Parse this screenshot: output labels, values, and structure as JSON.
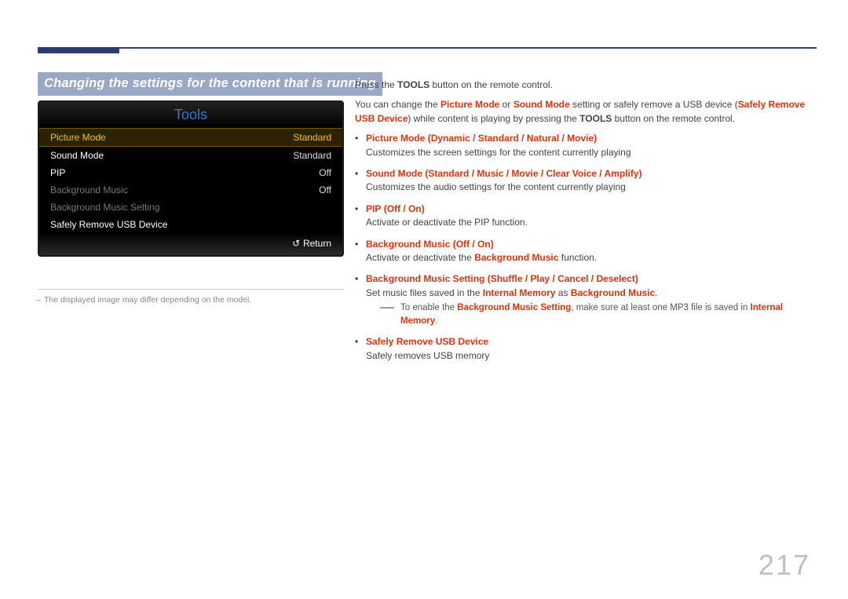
{
  "page_number": "217",
  "heading": "Changing the settings for the content that is running",
  "toolsbox": {
    "title": "Tools",
    "rows": [
      {
        "label": "Picture Mode",
        "value": "Standard",
        "state": "selected"
      },
      {
        "label": "Sound Mode",
        "value": "Standard",
        "state": "normal"
      },
      {
        "label": "PIP",
        "value": "Off",
        "state": "normal"
      },
      {
        "label": "Background Music",
        "value": "Off",
        "state": "dim"
      },
      {
        "label": "Background Music Setting",
        "value": "",
        "state": "dim"
      },
      {
        "label": "Safely Remove USB Device",
        "value": "",
        "state": "normal"
      }
    ],
    "footer": "Return"
  },
  "image_note": "The displayed image may differ depending on the model.",
  "intro1_a": "Press the ",
  "intro1_b": "TOOLS",
  "intro1_c": " button on the remote control.",
  "intro2_a": "You can change the ",
  "intro2_b": "Picture Mode",
  "intro2_c": " or ",
  "intro2_d": "Sound Mode",
  "intro2_e": " setting or safely remove a USB device (",
  "intro2_f": "Safely Remove USB Device",
  "intro2_g": ") while content is playing by pressing the ",
  "intro2_h": "TOOLS",
  "intro2_i": " button on the remote control.",
  "items": {
    "picture_mode": {
      "name": "Picture Mode",
      "opts": [
        "Dynamic",
        "Standard",
        "Natural",
        "Movie"
      ],
      "desc": "Customizes the screen settings for the content currently playing"
    },
    "sound_mode": {
      "name": "Sound Mode",
      "opts": [
        "Standard",
        "Music",
        "Movie",
        "Clear Voice",
        "Amplify"
      ],
      "desc": "Customizes the audio settings for the content currently playing"
    },
    "pip": {
      "name": "PIP",
      "opts": [
        "Off",
        "On"
      ],
      "desc": "Activate or deactivate the PIP function."
    },
    "bg_music": {
      "name": "Background Music",
      "opts": [
        "Off",
        "On"
      ],
      "desc_a": "Activate or deactivate the ",
      "desc_b": "Background Music",
      "desc_c": " function."
    },
    "bg_music_setting": {
      "name": "Background Music Setting",
      "opts": [
        "Shuffle",
        "Play",
        "Cancel",
        "Deselect"
      ],
      "desc_a": "Set music files saved in the ",
      "desc_b": "Internal Memory",
      "desc_c": " as ",
      "desc_d": "Background Music",
      "desc_e": "."
    },
    "safe_remove": {
      "name": "Safely Remove USB Device",
      "desc": "Safely removes USB memory"
    }
  },
  "bgms_note_a": "To enable the ",
  "bgms_note_b": "Background Music Setting",
  "bgms_note_c": ", make sure at least one MP3 file is saved in ",
  "bgms_note_d": "Internal Memory",
  "bgms_note_e": "."
}
